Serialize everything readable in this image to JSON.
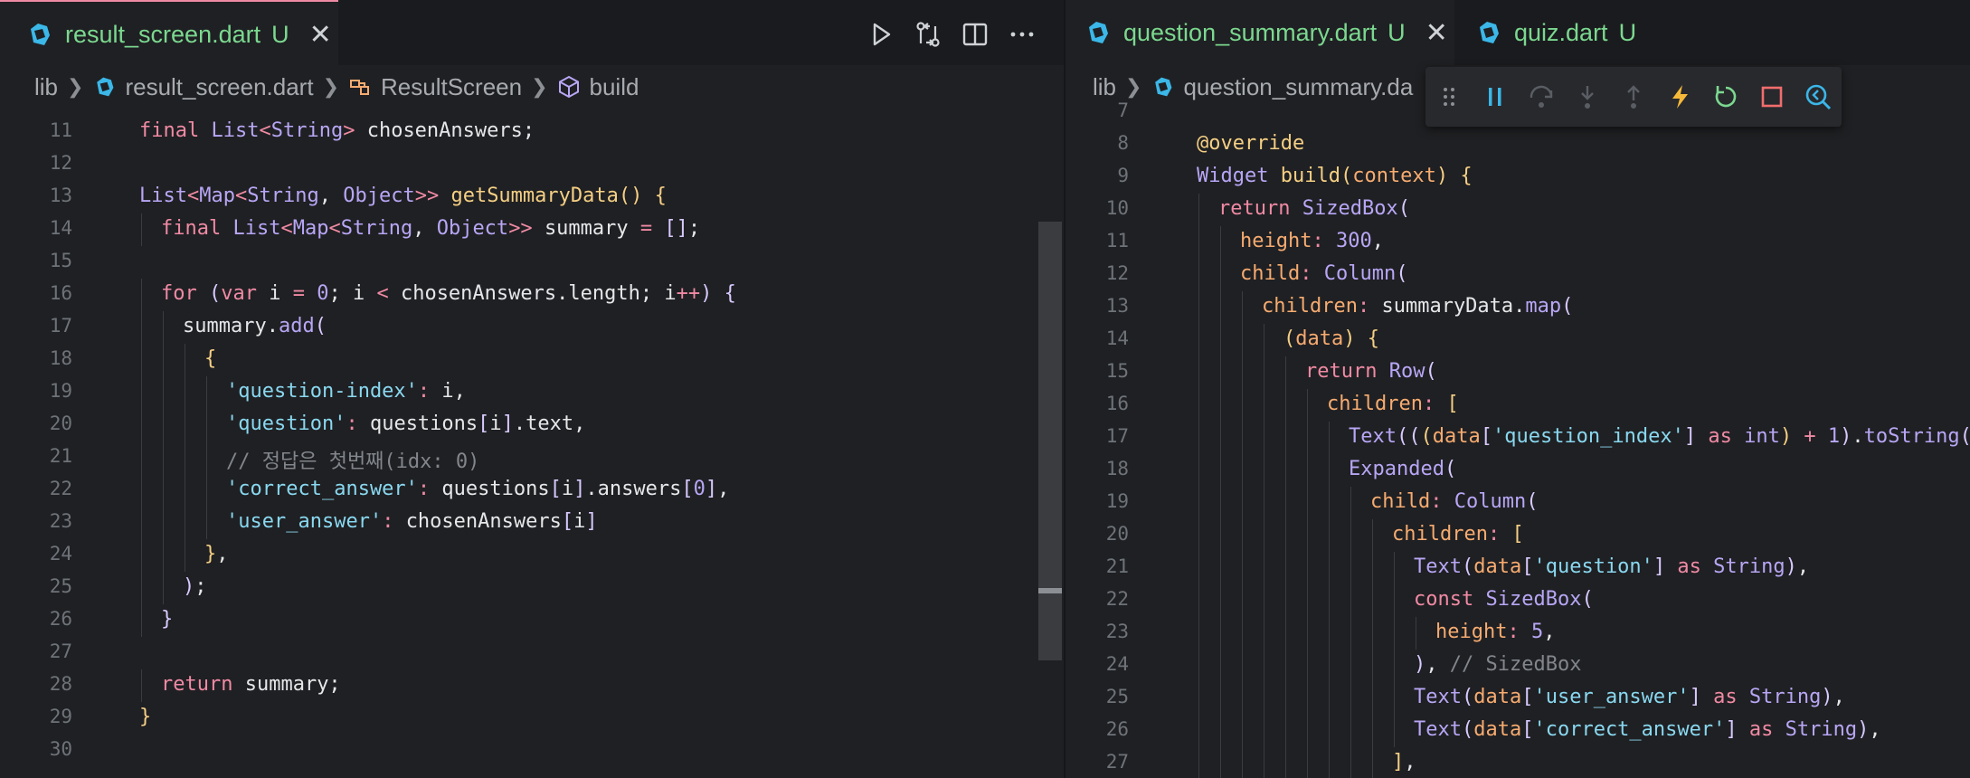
{
  "left_pane": {
    "tab": {
      "name": "result_screen.dart",
      "status": "U"
    },
    "breadcrumb": [
      "lib",
      "result_screen.dart",
      "ResultScreen",
      "build"
    ],
    "lines": [
      {
        "n": "11",
        "indent": 1,
        "tokens": [
          [
            "kw",
            "final "
          ],
          [
            "type",
            "List"
          ],
          [
            "op",
            "<"
          ],
          [
            "type",
            "String"
          ],
          [
            "op",
            "> "
          ],
          [
            "id",
            "chosenAnswers;"
          ]
        ]
      },
      {
        "n": "12",
        "indent": 0,
        "tokens": []
      },
      {
        "n": "13",
        "indent": 1,
        "tokens": [
          [
            "type",
            "List"
          ],
          [
            "op",
            "<"
          ],
          [
            "type",
            "Map"
          ],
          [
            "op",
            "<"
          ],
          [
            "type",
            "String"
          ],
          [
            "id",
            ", "
          ],
          [
            "type",
            "Object"
          ],
          [
            "op",
            ">> "
          ],
          [
            "fn",
            "getSummaryData"
          ],
          [
            "br",
            "() {"
          ]
        ]
      },
      {
        "n": "14",
        "indent": 2,
        "tokens": [
          [
            "kw",
            "final "
          ],
          [
            "type",
            "List"
          ],
          [
            "op",
            "<"
          ],
          [
            "type",
            "Map"
          ],
          [
            "op",
            "<"
          ],
          [
            "type",
            "String"
          ],
          [
            "id",
            ", "
          ],
          [
            "type",
            "Object"
          ],
          [
            "op",
            ">> "
          ],
          [
            "id",
            "summary "
          ],
          [
            "op",
            "= "
          ],
          [
            "pn",
            "[]"
          ],
          [
            "id",
            ";"
          ]
        ]
      },
      {
        "n": "15",
        "indent": 0,
        "tokens": []
      },
      {
        "n": "16",
        "indent": 2,
        "tokens": [
          [
            "kw",
            "for "
          ],
          [
            "pn",
            "("
          ],
          [
            "kw",
            "var "
          ],
          [
            "id",
            "i "
          ],
          [
            "op",
            "= "
          ],
          [
            "num",
            "0"
          ],
          [
            "id",
            "; i "
          ],
          [
            "op",
            "< "
          ],
          [
            "id",
            "chosenAnswers.length; i"
          ],
          [
            "op",
            "++"
          ],
          [
            "pn",
            ") {"
          ]
        ]
      },
      {
        "n": "17",
        "indent": 3,
        "tokens": [
          [
            "id",
            "summary."
          ],
          [
            "type",
            "add"
          ],
          [
            "pn",
            "("
          ]
        ]
      },
      {
        "n": "18",
        "indent": 4,
        "tokens": [
          [
            "br",
            "{"
          ]
        ]
      },
      {
        "n": "19",
        "indent": 5,
        "tokens": [
          [
            "str",
            "'question-index'"
          ],
          [
            "op",
            ": "
          ],
          [
            "id",
            "i,"
          ]
        ]
      },
      {
        "n": "20",
        "indent": 5,
        "tokens": [
          [
            "str",
            "'question'"
          ],
          [
            "op",
            ": "
          ],
          [
            "id",
            "questions"
          ],
          [
            "pn",
            "["
          ],
          [
            "id",
            "i"
          ],
          [
            "pn",
            "]"
          ],
          [
            "id",
            ".text,"
          ]
        ]
      },
      {
        "n": "21",
        "indent": 5,
        "tokens": [
          [
            "cm",
            "// 정답은 첫번째(idx: 0)"
          ]
        ]
      },
      {
        "n": "22",
        "indent": 5,
        "tokens": [
          [
            "str",
            "'correct_answer'"
          ],
          [
            "op",
            ": "
          ],
          [
            "id",
            "questions"
          ],
          [
            "pn",
            "["
          ],
          [
            "id",
            "i"
          ],
          [
            "pn",
            "]"
          ],
          [
            "id",
            ".answers"
          ],
          [
            "pn",
            "["
          ],
          [
            "num",
            "0"
          ],
          [
            "pn",
            "]"
          ],
          [
            "id",
            ","
          ]
        ]
      },
      {
        "n": "23",
        "indent": 5,
        "tokens": [
          [
            "str",
            "'user_answer'"
          ],
          [
            "op",
            ": "
          ],
          [
            "id",
            "chosenAnswers"
          ],
          [
            "pn",
            "["
          ],
          [
            "id",
            "i"
          ],
          [
            "pn",
            "]"
          ]
        ]
      },
      {
        "n": "24",
        "indent": 4,
        "tokens": [
          [
            "br",
            "}"
          ],
          [
            "id",
            ","
          ]
        ]
      },
      {
        "n": "25",
        "indent": 3,
        "tokens": [
          [
            "pn",
            ")"
          ],
          [
            "id",
            ";"
          ]
        ]
      },
      {
        "n": "26",
        "indent": 2,
        "tokens": [
          [
            "pn",
            "}"
          ]
        ]
      },
      {
        "n": "27",
        "indent": 0,
        "tokens": []
      },
      {
        "n": "28",
        "indent": 2,
        "tokens": [
          [
            "kw",
            "return "
          ],
          [
            "id",
            "summary;"
          ]
        ]
      },
      {
        "n": "29",
        "indent": 1,
        "tokens": [
          [
            "br",
            "}"
          ]
        ]
      },
      {
        "n": "30",
        "indent": 0,
        "tokens": []
      }
    ]
  },
  "right_pane": {
    "tabs": [
      {
        "name": "question_summary.dart",
        "status": "U",
        "active": true
      },
      {
        "name": "quiz.dart",
        "status": "U",
        "active": false
      }
    ],
    "breadcrumb": [
      "lib",
      "question_summary.da"
    ],
    "lines": [
      {
        "n": "7",
        "indent": 0,
        "tokens": []
      },
      {
        "n": "8",
        "indent": 1,
        "tokens": [
          [
            "fn",
            "@override"
          ]
        ]
      },
      {
        "n": "9",
        "indent": 1,
        "tokens": [
          [
            "type",
            "Widget "
          ],
          [
            "fn",
            "build"
          ],
          [
            "br",
            "("
          ],
          [
            "prop",
            "context"
          ],
          [
            "br",
            ") {"
          ]
        ]
      },
      {
        "n": "10",
        "indent": 2,
        "tokens": [
          [
            "kw",
            "return "
          ],
          [
            "type",
            "SizedBox"
          ],
          [
            "pn",
            "("
          ]
        ]
      },
      {
        "n": "11",
        "indent": 3,
        "tokens": [
          [
            "prop",
            "height"
          ],
          [
            "op",
            ": "
          ],
          [
            "num",
            "300"
          ],
          [
            "id",
            ","
          ]
        ]
      },
      {
        "n": "12",
        "indent": 3,
        "tokens": [
          [
            "prop",
            "child"
          ],
          [
            "op",
            ": "
          ],
          [
            "type",
            "Column"
          ],
          [
            "pn",
            "("
          ]
        ]
      },
      {
        "n": "13",
        "indent": 4,
        "tokens": [
          [
            "prop",
            "children"
          ],
          [
            "op",
            ": "
          ],
          [
            "id",
            "summaryData."
          ],
          [
            "type",
            "map"
          ],
          [
            "pn",
            "("
          ]
        ]
      },
      {
        "n": "14",
        "indent": 5,
        "tokens": [
          [
            "br",
            "("
          ],
          [
            "prop",
            "data"
          ],
          [
            "br",
            ") {"
          ]
        ]
      },
      {
        "n": "15",
        "indent": 6,
        "tokens": [
          [
            "kw",
            "return "
          ],
          [
            "type",
            "Row"
          ],
          [
            "pn",
            "("
          ]
        ]
      },
      {
        "n": "16",
        "indent": 7,
        "tokens": [
          [
            "prop",
            "children"
          ],
          [
            "op",
            ": "
          ],
          [
            "br",
            "["
          ]
        ]
      },
      {
        "n": "17",
        "indent": 8,
        "tokens": [
          [
            "type",
            "Text"
          ],
          [
            "pn",
            "(("
          ],
          [
            "br",
            "("
          ],
          [
            "prop",
            "data"
          ],
          [
            "pn",
            "["
          ],
          [
            "str",
            "'question_index'"
          ],
          [
            "pn",
            "] "
          ],
          [
            "kw",
            "as "
          ],
          [
            "type",
            "int"
          ],
          [
            "br",
            ") "
          ],
          [
            "op",
            "+ "
          ],
          [
            "num",
            "1"
          ],
          [
            "pn",
            ")"
          ],
          [
            "id",
            "."
          ],
          [
            "type",
            "toString"
          ],
          [
            "pn",
            "())"
          ],
          [
            "id",
            ","
          ]
        ]
      },
      {
        "n": "18",
        "indent": 8,
        "tokens": [
          [
            "type",
            "Expanded"
          ],
          [
            "pn",
            "("
          ]
        ]
      },
      {
        "n": "19",
        "indent": 9,
        "tokens": [
          [
            "prop",
            "child"
          ],
          [
            "op",
            ": "
          ],
          [
            "type",
            "Column"
          ],
          [
            "pn",
            "("
          ]
        ]
      },
      {
        "n": "20",
        "indent": 10,
        "tokens": [
          [
            "prop",
            "children"
          ],
          [
            "op",
            ": "
          ],
          [
            "br",
            "["
          ]
        ]
      },
      {
        "n": "21",
        "indent": 11,
        "tokens": [
          [
            "type",
            "Text"
          ],
          [
            "pn",
            "("
          ],
          [
            "prop",
            "data"
          ],
          [
            "pn",
            "["
          ],
          [
            "str",
            "'question'"
          ],
          [
            "pn",
            "] "
          ],
          [
            "kw",
            "as "
          ],
          [
            "type",
            "String"
          ],
          [
            "pn",
            ")"
          ],
          [
            "id",
            ","
          ]
        ]
      },
      {
        "n": "22",
        "indent": 11,
        "tokens": [
          [
            "kw",
            "const "
          ],
          [
            "type",
            "SizedBox"
          ],
          [
            "pn",
            "("
          ]
        ]
      },
      {
        "n": "23",
        "indent": 12,
        "tokens": [
          [
            "prop",
            "height"
          ],
          [
            "op",
            ": "
          ],
          [
            "num",
            "5"
          ],
          [
            "id",
            ","
          ]
        ]
      },
      {
        "n": "24",
        "indent": 11,
        "tokens": [
          [
            "pn",
            ")"
          ],
          [
            "id",
            ", "
          ],
          [
            "cm",
            "// SizedBox"
          ]
        ]
      },
      {
        "n": "25",
        "indent": 11,
        "tokens": [
          [
            "type",
            "Text"
          ],
          [
            "pn",
            "("
          ],
          [
            "prop",
            "data"
          ],
          [
            "pn",
            "["
          ],
          [
            "str",
            "'user_answer'"
          ],
          [
            "pn",
            "] "
          ],
          [
            "kw",
            "as "
          ],
          [
            "type",
            "String"
          ],
          [
            "pn",
            ")"
          ],
          [
            "id",
            ","
          ]
        ]
      },
      {
        "n": "26",
        "indent": 11,
        "tokens": [
          [
            "type",
            "Text"
          ],
          [
            "pn",
            "("
          ],
          [
            "prop",
            "data"
          ],
          [
            "pn",
            "["
          ],
          [
            "str",
            "'correct_answer'"
          ],
          [
            "pn",
            "] "
          ],
          [
            "kw",
            "as "
          ],
          [
            "type",
            "String"
          ],
          [
            "pn",
            ")"
          ],
          [
            "id",
            ","
          ]
        ]
      },
      {
        "n": "27",
        "indent": 10,
        "tokens": [
          [
            "br",
            "]"
          ],
          [
            "id",
            ","
          ]
        ]
      }
    ]
  },
  "toolbar": {
    "run_icon": "play-icon",
    "compare_icon": "source-compare-icon",
    "split_icon": "split-editor-icon",
    "more_icon": "ellipsis-icon"
  },
  "debug_toolbar": [
    "drag-handle-icon",
    "pause-icon",
    "step-over-icon",
    "step-into-icon",
    "step-out-icon",
    "hot-reload-icon",
    "hot-restart-icon",
    "stop-icon",
    "devtools-icon"
  ],
  "colors": {
    "untracked_green": "#7bd88f",
    "tab_accent": "#f08aa4",
    "dart_blue": "#3bb7e8"
  }
}
